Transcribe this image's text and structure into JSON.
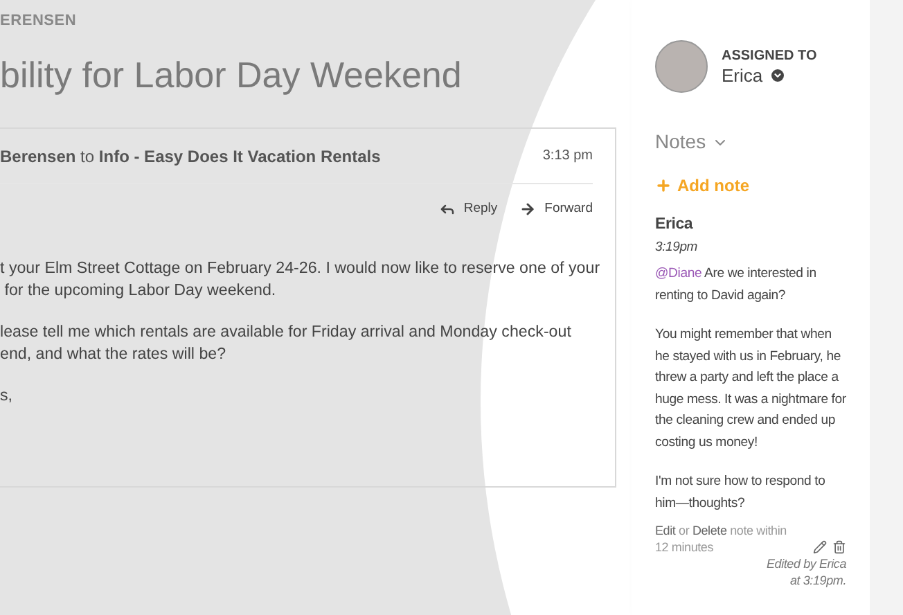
{
  "sender_caption": "ERENSEN",
  "subject": "bility for Labor Day Weekend",
  "message": {
    "from": "Berensen",
    "to_word": "to",
    "recipient": "Info - Easy Does It Vacation Rentals",
    "time": "3:13 pm",
    "actions": [
      {
        "kind": "reply",
        "label": "Reply"
      },
      {
        "kind": "forward",
        "label": "Forward"
      }
    ],
    "body": [
      [
        "t your Elm Street Cottage on February 24-26. I would now like to reserve one of your",
        " for the upcoming Labor Day weekend."
      ],
      [
        "lease tell me which rentals are available for Friday arrival and Monday check-out",
        "end, and what the rates will be?"
      ],
      [
        "s,"
      ]
    ]
  },
  "assignment": {
    "caption": "ASSIGNED TO",
    "assignee": "Erica"
  },
  "notes": {
    "heading": "Notes",
    "expanded": true,
    "add_label": "Add note",
    "note": {
      "author": "Erica",
      "time": "3:19pm",
      "mention": "@Diane",
      "paragraphs": [
        "Are we interested in renting to David again?",
        "You might remember that when he stayed with us in February, he threw a party and left the place a huge mess. It was a nightmare for the cleaning crew and ended up costing us money!",
        "I'm not sure how to respond to him—thoughts?"
      ],
      "edit_link": "Edit",
      "or_word": "or",
      "delete_link": "Delete",
      "limit_text": "note within 12 minutes",
      "edited_line_1": "Edited by Erica",
      "edited_line_2": "at 3:19pm."
    }
  }
}
